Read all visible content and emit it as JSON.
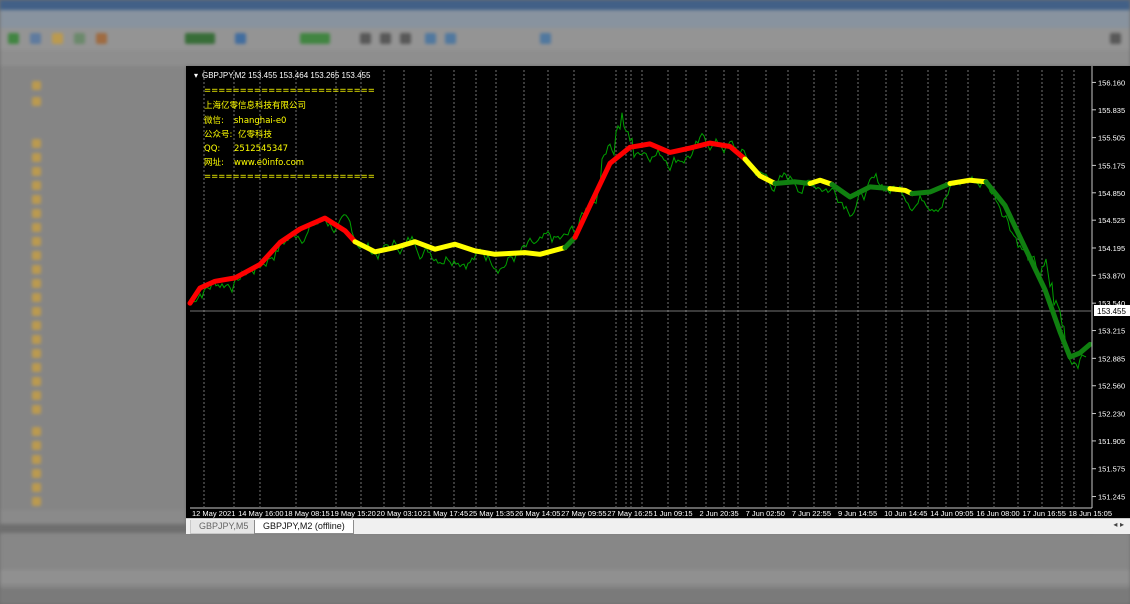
{
  "chart_window": {
    "symbol_header": "GBPJPY,M2  153.455 153.464 153.265 153.455",
    "info_box": {
      "separator": "========================",
      "company": "上海亿零信息科技有限公司",
      "wechat_label": "微信:",
      "wechat_value": "shanghai-e0",
      "official_label": "公众号:",
      "official_value": "亿零科技",
      "qq_label": "QQ:",
      "qq_value": "2512545347",
      "web_label": "网址:",
      "web_value": "www.e0info.com",
      "separator2": "========================"
    },
    "tabs": [
      {
        "label": "GBPJPY,M5",
        "active": false
      },
      {
        "label": "GBPJPY,M2 (offline)",
        "active": true
      }
    ],
    "colors": {
      "background": "#000000",
      "price_line": "#00a000",
      "trend_up": "#ff0000",
      "trend_flat": "#ffff00",
      "trend_down": "#108010",
      "grid": "#c8c8c8",
      "text": "#ffffff",
      "info_text": "#ffff00"
    }
  },
  "chart_data": {
    "type": "line",
    "y_ticks": [
      "156.160",
      "155.835",
      "155.505",
      "155.175",
      "154.850",
      "154.525",
      "154.195",
      "153.870",
      "153.540",
      "153.455",
      "153.215",
      "152.885",
      "152.560",
      "152.230",
      "151.905",
      "151.575",
      "151.245"
    ],
    "current_price": "153.455",
    "x_ticks": [
      "12 May 2021",
      "14 May 16:00",
      "18 May 08:15",
      "19 May 15:20",
      "20 May 03:10",
      "21 May 17:45",
      "25 May 15:35",
      "26 May 14:05",
      "27 May 09:55",
      "27 May 16:25",
      "1 Jun 09:15",
      "2 Jun 20:35",
      "7 Jun 02:50",
      "7 Jun 22:55",
      "9 Jun 14:55",
      "10 Jun 14:45",
      "14 Jun 09:05",
      "16 Jun 08:00",
      "17 Jun 16:55",
      "18 Jun 15:05"
    ],
    "ylim": [
      151.18,
      156.26
    ],
    "trend_series": [
      {
        "color": "red",
        "points": [
          [
            0,
            153.54
          ],
          [
            10,
            153.72
          ],
          [
            25,
            153.8
          ],
          [
            45,
            153.84
          ],
          [
            70,
            154.0
          ],
          [
            90,
            154.26
          ],
          [
            110,
            154.42
          ],
          [
            135,
            154.55
          ],
          [
            155,
            154.4
          ],
          [
            165,
            154.27
          ]
        ]
      },
      {
        "color": "yellow",
        "points": [
          [
            165,
            154.27
          ],
          [
            185,
            154.15
          ],
          [
            205,
            154.2
          ],
          [
            225,
            154.27
          ],
          [
            245,
            154.18
          ],
          [
            265,
            154.24
          ],
          [
            285,
            154.16
          ],
          [
            305,
            154.12
          ],
          [
            335,
            154.14
          ],
          [
            350,
            154.12
          ],
          [
            375,
            154.2
          ]
        ]
      },
      {
        "color": "green",
        "points": [
          [
            375,
            154.2
          ],
          [
            385,
            154.32
          ]
        ]
      },
      {
        "color": "red",
        "points": [
          [
            385,
            154.32
          ],
          [
            400,
            154.7
          ],
          [
            420,
            155.2
          ],
          [
            440,
            155.39
          ],
          [
            460,
            155.43
          ],
          [
            480,
            155.33
          ],
          [
            500,
            155.38
          ],
          [
            520,
            155.44
          ],
          [
            540,
            155.4
          ],
          [
            555,
            155.25
          ]
        ]
      },
      {
        "color": "yellow",
        "points": [
          [
            555,
            155.25
          ],
          [
            570,
            155.05
          ],
          [
            585,
            154.96
          ]
        ]
      },
      {
        "color": "green",
        "points": [
          [
            585,
            154.96
          ],
          [
            605,
            154.98
          ],
          [
            620,
            154.96
          ]
        ]
      },
      {
        "color": "yellow",
        "points": [
          [
            620,
            154.96
          ],
          [
            630,
            155.0
          ],
          [
            642,
            154.95
          ]
        ]
      },
      {
        "color": "green",
        "points": [
          [
            642,
            154.95
          ],
          [
            660,
            154.8
          ],
          [
            680,
            154.92
          ],
          [
            700,
            154.9
          ]
        ]
      },
      {
        "color": "yellow",
        "points": [
          [
            700,
            154.9
          ],
          [
            715,
            154.88
          ],
          [
            722,
            154.84
          ]
        ]
      },
      {
        "color": "green",
        "points": [
          [
            722,
            154.84
          ],
          [
            740,
            154.86
          ],
          [
            760,
            154.96
          ]
        ]
      },
      {
        "color": "yellow",
        "points": [
          [
            760,
            154.96
          ],
          [
            780,
            155.0
          ],
          [
            796,
            154.98
          ]
        ]
      },
      {
        "color": "green",
        "points": [
          [
            796,
            154.98
          ],
          [
            815,
            154.7
          ],
          [
            835,
            154.2
          ],
          [
            855,
            153.7
          ],
          [
            870,
            153.2
          ],
          [
            880,
            152.9
          ],
          [
            890,
            152.95
          ],
          [
            900,
            153.05
          ]
        ]
      }
    ]
  }
}
